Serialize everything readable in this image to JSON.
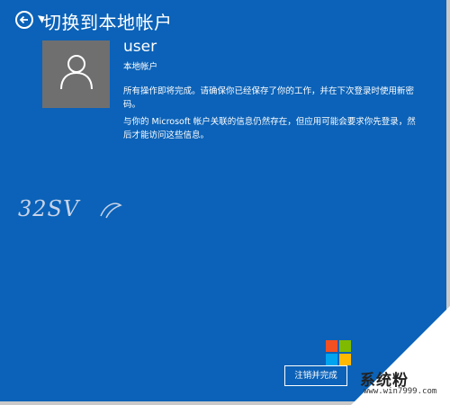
{
  "header": {
    "title": "切换到本地帐户",
    "back_icon": "back-arrow-icon"
  },
  "account": {
    "username": "user",
    "type": "本地帐户",
    "avatar_icon": "user-silhouette-icon"
  },
  "messages": [
    "所有操作即将完成。请确保你已经保存了你的工作，并在下次登录时使用新密码。",
    "与你的 Microsoft 帐户关联的信息仍然存在，但应用可能会要求你先登录，然后才能访问这些信息。"
  ],
  "actions": {
    "finish_label": "注销并完成"
  },
  "logo_text": "32SV",
  "watermark": {
    "site_name": "系统粉",
    "url": "www.win7999.com"
  },
  "colors": {
    "background": "#0b62b8",
    "avatar_bg": "#6f6f6f",
    "text": "#ffffff"
  }
}
